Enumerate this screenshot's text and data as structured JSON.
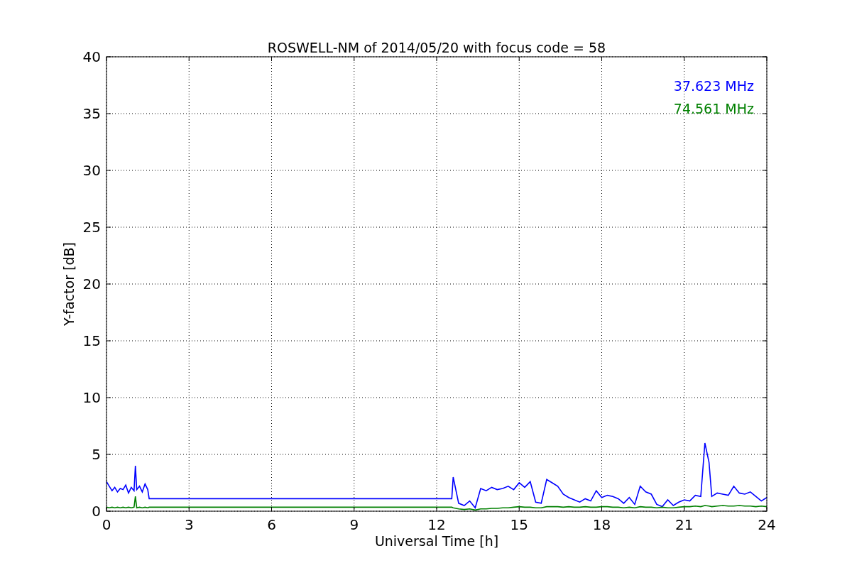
{
  "chart_data": {
    "type": "line",
    "title": "ROSWELL-NM of 2014/05/20 with focus code = 58",
    "xlabel": "Universal Time [h]",
    "ylabel": "Y-factor [dB]",
    "xlim": [
      0,
      24
    ],
    "ylim": [
      0,
      40
    ],
    "xticks": [
      0,
      3,
      6,
      9,
      12,
      15,
      18,
      21,
      24
    ],
    "yticks": [
      0,
      5,
      10,
      15,
      20,
      25,
      30,
      35,
      40
    ],
    "grid": true,
    "x": [
      0,
      0.1,
      0.2,
      0.3,
      0.4,
      0.5,
      0.6,
      0.7,
      0.8,
      0.9,
      1.0,
      1.05,
      1.1,
      1.2,
      1.3,
      1.4,
      1.5,
      1.55,
      12.55,
      12.6,
      12.8,
      13.0,
      13.2,
      13.4,
      13.6,
      13.8,
      14.0,
      14.2,
      14.4,
      14.6,
      14.8,
      15.0,
      15.2,
      15.4,
      15.6,
      15.8,
      16.0,
      16.2,
      16.4,
      16.6,
      16.8,
      17.0,
      17.2,
      17.4,
      17.6,
      17.8,
      18.0,
      18.2,
      18.4,
      18.6,
      18.8,
      19.0,
      19.2,
      19.4,
      19.6,
      19.8,
      20.0,
      20.2,
      20.4,
      20.6,
      20.8,
      21.0,
      21.2,
      21.4,
      21.6,
      21.75,
      21.9,
      22.0,
      22.2,
      22.4,
      22.6,
      22.8,
      23.0,
      23.2,
      23.4,
      23.6,
      23.8,
      24.0
    ],
    "series": [
      {
        "name": "37.623 MHz",
        "color": "#0000ff",
        "values": [
          2.6,
          2.2,
          1.8,
          2.1,
          1.7,
          2.0,
          1.9,
          2.3,
          1.6,
          2.1,
          1.8,
          4.0,
          1.9,
          2.2,
          1.7,
          2.4,
          1.9,
          1.1,
          1.1,
          3.0,
          0.7,
          0.5,
          0.9,
          0.3,
          2.0,
          1.8,
          2.1,
          1.9,
          2.0,
          2.2,
          1.9,
          2.5,
          2.1,
          2.6,
          0.8,
          0.7,
          2.8,
          2.5,
          2.2,
          1.5,
          1.2,
          1.0,
          0.8,
          1.1,
          0.9,
          1.8,
          1.2,
          1.4,
          1.3,
          1.1,
          0.7,
          1.2,
          0.6,
          2.2,
          1.7,
          1.5,
          0.6,
          0.4,
          1.0,
          0.5,
          0.8,
          1.0,
          0.9,
          1.4,
          1.3,
          6.0,
          4.3,
          1.3,
          1.6,
          1.5,
          1.4,
          2.2,
          1.6,
          1.5,
          1.7,
          1.3,
          0.9,
          1.2
        ]
      },
      {
        "name": "74.561 MHz",
        "color": "#008000",
        "values": [
          0.35,
          0.3,
          0.35,
          0.3,
          0.35,
          0.3,
          0.35,
          0.3,
          0.35,
          0.3,
          0.35,
          1.3,
          0.3,
          0.35,
          0.3,
          0.35,
          0.3,
          0.35,
          0.35,
          0.3,
          0.2,
          0.15,
          0.2,
          0.1,
          0.2,
          0.2,
          0.25,
          0.25,
          0.3,
          0.3,
          0.35,
          0.4,
          0.35,
          0.35,
          0.3,
          0.3,
          0.4,
          0.4,
          0.4,
          0.35,
          0.4,
          0.35,
          0.35,
          0.4,
          0.35,
          0.35,
          0.4,
          0.4,
          0.35,
          0.35,
          0.3,
          0.35,
          0.3,
          0.4,
          0.35,
          0.35,
          0.3,
          0.35,
          0.3,
          0.3,
          0.35,
          0.4,
          0.4,
          0.45,
          0.4,
          0.5,
          0.45,
          0.4,
          0.45,
          0.5,
          0.45,
          0.45,
          0.5,
          0.45,
          0.45,
          0.4,
          0.45,
          0.4
        ]
      }
    ]
  }
}
